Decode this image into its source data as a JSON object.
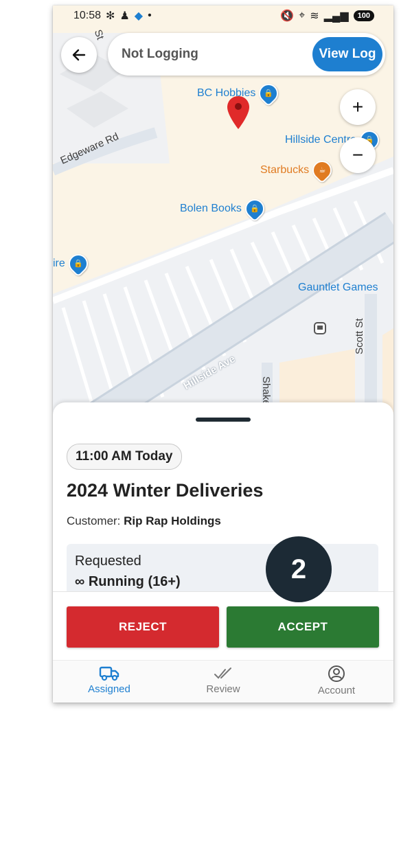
{
  "status_bar": {
    "time": "10:58",
    "battery": "100"
  },
  "header": {
    "log_status": "Not Logging",
    "view_log_label": "View Log"
  },
  "map": {
    "pois": [
      {
        "name": "BC Hobbies",
        "color": "#1e7fd0"
      },
      {
        "name": "Hillside Centre",
        "color": "#1e7fd0"
      },
      {
        "name": "Starbucks",
        "color": "#e07b22"
      },
      {
        "name": "Bolen Books",
        "color": "#1e7fd0"
      },
      {
        "name": "ire",
        "color": "#1e7fd0"
      },
      {
        "name": "Gauntlet Games",
        "color": "#1e7fd0"
      }
    ],
    "streets": [
      "Edgeware Rd",
      "Hillside Ave",
      "Scott St",
      "Shake",
      "St"
    ],
    "zoom_in": "+",
    "zoom_out": "−"
  },
  "job": {
    "time": "11:00 AM Today",
    "title": "2024 Winter Deliveries",
    "customer_label": "Customer:",
    "customer_name": "Rip Rap Holdings",
    "requested_label": "Requested",
    "requested_value": "∞ Running (16+)"
  },
  "step_badge": "2",
  "actions": {
    "reject": "REJECT",
    "accept": "ACCEPT"
  },
  "nav": {
    "items": [
      {
        "label": "Assigned",
        "icon": "truck-icon",
        "active": true
      },
      {
        "label": "Review",
        "icon": "double-check-icon",
        "active": false
      },
      {
        "label": "Account",
        "icon": "account-circle-icon",
        "active": false
      }
    ]
  },
  "colors": {
    "primary": "#1e7fd0",
    "reject": "#d42a2f",
    "accept": "#2b7a33",
    "badge": "#1c2a35"
  }
}
